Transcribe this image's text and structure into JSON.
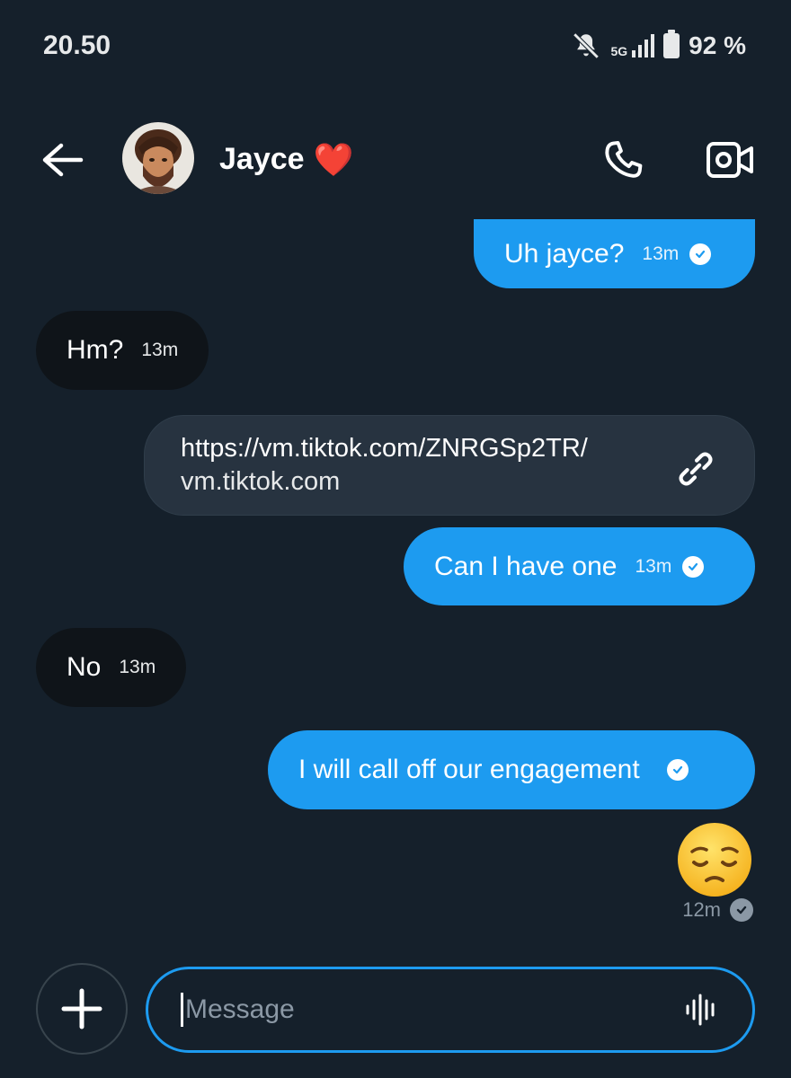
{
  "status_bar": {
    "time": "20.50",
    "network": "5G",
    "battery": "92 %"
  },
  "header": {
    "contact_name": "Jayce",
    "heart": "❤️",
    "icons": [
      "back-arrow-icon",
      "phone-icon",
      "video-camera-icon"
    ]
  },
  "messages": [
    {
      "direction": "sent",
      "text": "Uh jayce?",
      "time": "13m",
      "read": true
    },
    {
      "direction": "received",
      "text": "Hm?",
      "time": "13m"
    },
    {
      "direction": "sent",
      "type": "link",
      "url": "https://vm.tiktok.com/ZNRGSp2TR/",
      "domain": "vm.tiktok.com"
    },
    {
      "direction": "sent",
      "text": "Can I have one",
      "time": "13m",
      "read": true
    },
    {
      "direction": "received",
      "text": "No",
      "time": "13m"
    },
    {
      "direction": "sent",
      "text": "I will call off our engagement",
      "time": "",
      "read": true
    },
    {
      "direction": "sent",
      "type": "emoji",
      "emoji": "pensive-face",
      "time": "12m",
      "read": true
    }
  ],
  "composer": {
    "placeholder": "Message"
  },
  "colors": {
    "background": "#15202b",
    "sent_bubble": "#1d9bf0",
    "received_bubble": "#0f1419",
    "link_card": "#273340"
  }
}
